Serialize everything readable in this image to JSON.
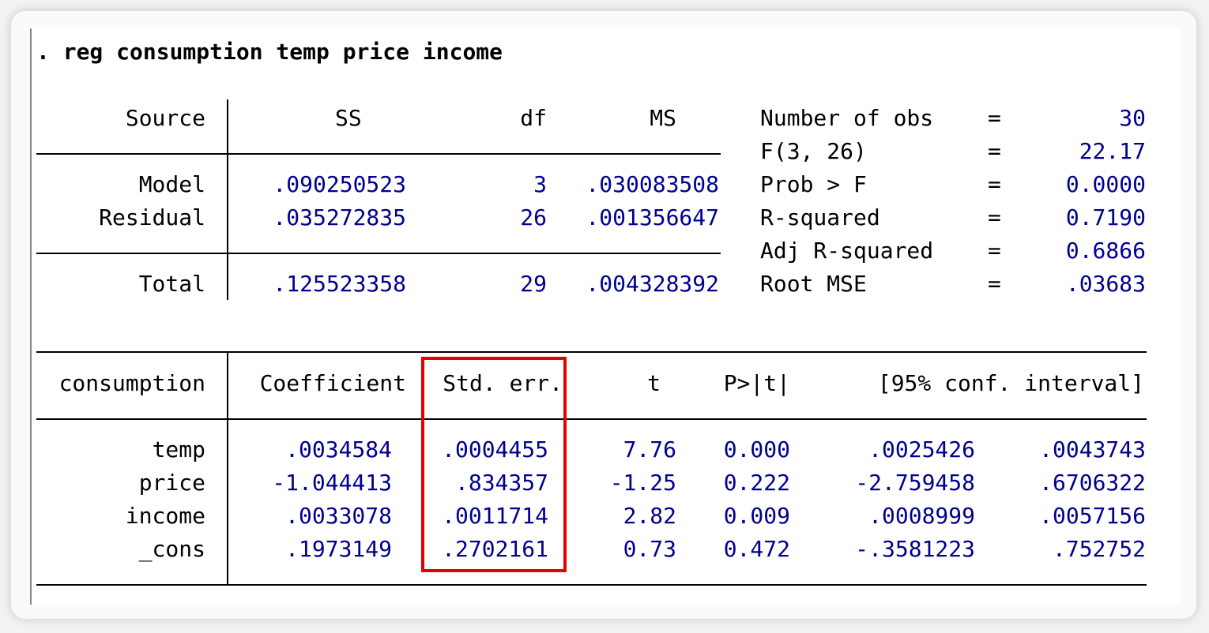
{
  "command": ". reg consumption temp price income",
  "anova": {
    "headers": {
      "source": "Source",
      "ss": "SS",
      "df": "df",
      "ms": "MS"
    },
    "rows": [
      {
        "source": "Model",
        "ss": ".090250523",
        "df": "3",
        "ms": ".030083508"
      },
      {
        "source": "Residual",
        "ss": ".035272835",
        "df": "26",
        "ms": ".001356647"
      }
    ],
    "total": {
      "source": "Total",
      "ss": ".125523358",
      "df": "29",
      "ms": ".004328392"
    }
  },
  "stats": [
    {
      "label": "Number of obs",
      "eq": "=",
      "value": "30"
    },
    {
      "label": "F(3, 26)",
      "eq": "=",
      "value": "22.17"
    },
    {
      "label": "Prob > F",
      "eq": "=",
      "value": "0.0000"
    },
    {
      "label": "R-squared",
      "eq": "=",
      "value": "0.7190"
    },
    {
      "label": "Adj R-squared",
      "eq": "=",
      "value": "0.6866"
    },
    {
      "label": "Root MSE",
      "eq": "=",
      "value": ".03683"
    }
  ],
  "coef_table": {
    "headers": {
      "depvar": "consumption",
      "coef": "Coefficient",
      "se": "Std. err.",
      "t": "t",
      "p": "P>|t|",
      "ci": "[95% conf. interval]"
    },
    "rows": [
      {
        "var": "temp",
        "coef": ".0034584",
        "se": ".0004455",
        "t": "7.76",
        "p": "0.000",
        "ci_low": ".0025426",
        "ci_high": ".0043743"
      },
      {
        "var": "price",
        "coef": "-1.044413",
        "se": ".834357",
        "t": "-1.25",
        "p": "0.222",
        "ci_low": "-2.759458",
        "ci_high": ".6706322"
      },
      {
        "var": "income",
        "coef": ".0033078",
        "se": ".0011714",
        "t": "2.82",
        "p": "0.009",
        "ci_low": ".0008999",
        "ci_high": ".0057156"
      },
      {
        "var": "_cons",
        "coef": ".1973149",
        "se": ".2702161",
        "t": "0.73",
        "p": "0.472",
        "ci_low": "-.3581223",
        "ci_high": ".752752"
      }
    ]
  },
  "colors": {
    "result_text": "#000090",
    "label_text": "#000000",
    "highlight_border": "#e80000"
  }
}
